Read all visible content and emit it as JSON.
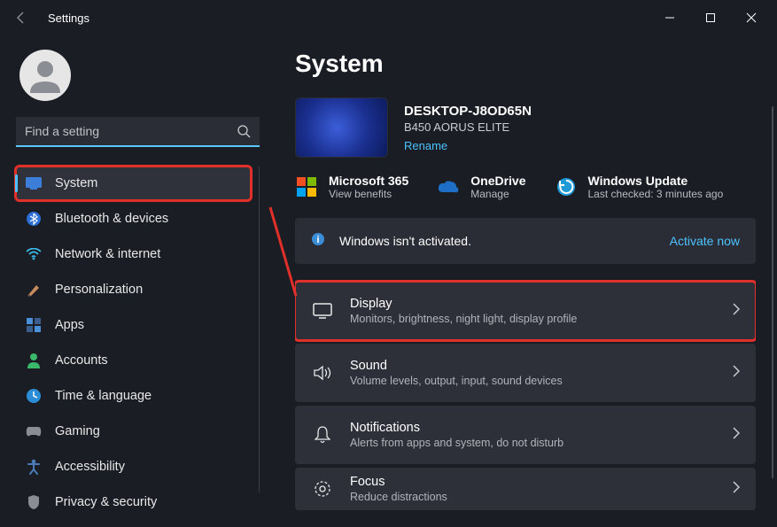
{
  "window": {
    "title": "Settings"
  },
  "search": {
    "placeholder": "Find a setting"
  },
  "sidebar": {
    "items": [
      {
        "label": "System"
      },
      {
        "label": "Bluetooth & devices"
      },
      {
        "label": "Network & internet"
      },
      {
        "label": "Personalization"
      },
      {
        "label": "Apps"
      },
      {
        "label": "Accounts"
      },
      {
        "label": "Time & language"
      },
      {
        "label": "Gaming"
      },
      {
        "label": "Accessibility"
      },
      {
        "label": "Privacy & security"
      }
    ]
  },
  "page": {
    "title": "System",
    "device": {
      "name": "DESKTOP-J8OD65N",
      "model": "B450 AORUS ELITE",
      "rename": "Rename"
    },
    "services": [
      {
        "title": "Microsoft 365",
        "sub": "View benefits"
      },
      {
        "title": "OneDrive",
        "sub": "Manage"
      },
      {
        "title": "Windows Update",
        "sub": "Last checked: 3 minutes ago"
      }
    ],
    "activation": {
      "msg": "Windows isn't activated.",
      "action": "Activate now"
    },
    "settings": [
      {
        "title": "Display",
        "desc": "Monitors, brightness, night light, display profile"
      },
      {
        "title": "Sound",
        "desc": "Volume levels, output, input, sound devices"
      },
      {
        "title": "Notifications",
        "desc": "Alerts from apps and system, do not disturb"
      },
      {
        "title": "Focus",
        "desc": "Reduce distractions"
      }
    ]
  }
}
